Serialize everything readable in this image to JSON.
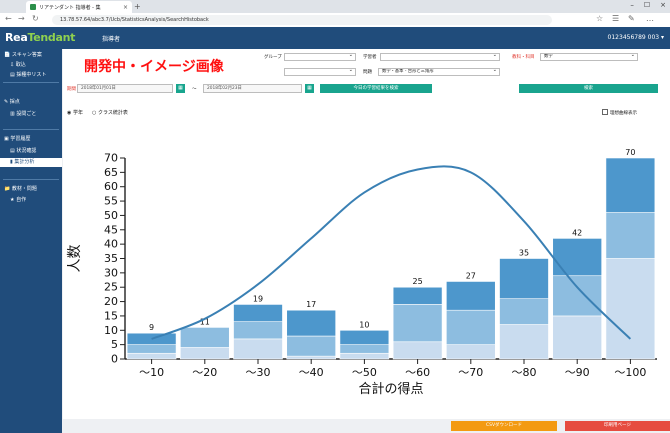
{
  "browser": {
    "tab_title": "リアテンダント 指導者 - 集",
    "url": "13.78.57.64/abc3.7/Ucb/StatisticsAnalysis/SearchHistoback"
  },
  "app": {
    "logo_main": "Rea",
    "logo_accent": "Tendant",
    "role": "指導者",
    "user_id": "0123456789 003 ▾"
  },
  "sidebar": {
    "sections": [
      {
        "label": "スキャン答案",
        "items": [
          "取込",
          "採種中リスト"
        ]
      },
      {
        "label": "採点",
        "items": [
          "設問ごと"
        ]
      },
      {
        "label": "学習履歴",
        "items": [
          "状況確認",
          "集計分析"
        ]
      },
      {
        "label": "教材・問題",
        "items": [
          "自作"
        ]
      }
    ],
    "active_item": "集計分析"
  },
  "main": {
    "banner": "開発中・イメージ画像",
    "filters": {
      "group_label": "グループ",
      "learner_label": "学習者",
      "subject_label": "教科・科目",
      "subject_value": "数学",
      "problem_label": "問題",
      "problem_value": "数学・基本 - 台形と三角形",
      "period_label": "期間",
      "date_from": "2018年01月01日",
      "date_sep": "〜",
      "date_to": "2018年02月23日",
      "today_button": "今日の学習結果を検索",
      "search_button": "検索"
    },
    "radios": {
      "student": "学年",
      "class": "クラス統計表"
    },
    "checkbox_label": "理想曲線表示"
  },
  "chart_data": {
    "type": "bar",
    "categories": [
      "〜10",
      "〜20",
      "〜30",
      "〜40",
      "〜50",
      "〜60",
      "〜70",
      "〜80",
      "〜90",
      "〜100"
    ],
    "series": [
      {
        "values": [
          2,
          4,
          7,
          1,
          2,
          6,
          5,
          12,
          15,
          35
        ],
        "color": "#c9dcef"
      },
      {
        "values": [
          3,
          7,
          6,
          7,
          3,
          13,
          12,
          9,
          14,
          16
        ],
        "color": "#8dbde0"
      },
      {
        "values": [
          4,
          0,
          6,
          9,
          5,
          6,
          10,
          14,
          13,
          19
        ],
        "color": "#4d97cc"
      }
    ],
    "totals": [
      9,
      11,
      19,
      17,
      10,
      25,
      27,
      35,
      42,
      70
    ],
    "ideal_curve": {
      "x": [
        0,
        1,
        2,
        3,
        4,
        5,
        6,
        7,
        8,
        9
      ],
      "y": [
        7,
        14,
        26,
        42,
        58,
        66,
        65,
        48,
        25,
        7
      ],
      "color": "#3a80b4"
    },
    "title": "",
    "xlabel": "合計の得点",
    "ylabel": "人数",
    "ylim": [
      0,
      70
    ],
    "yticks": [
      0,
      5,
      10,
      15,
      20,
      25,
      30,
      35,
      40,
      45,
      50,
      55,
      60,
      65,
      70
    ],
    "grid": false,
    "legend": "none"
  },
  "footer": {
    "csv_button": "CSVダウンロード",
    "prev_button": "印刷用ページ"
  }
}
